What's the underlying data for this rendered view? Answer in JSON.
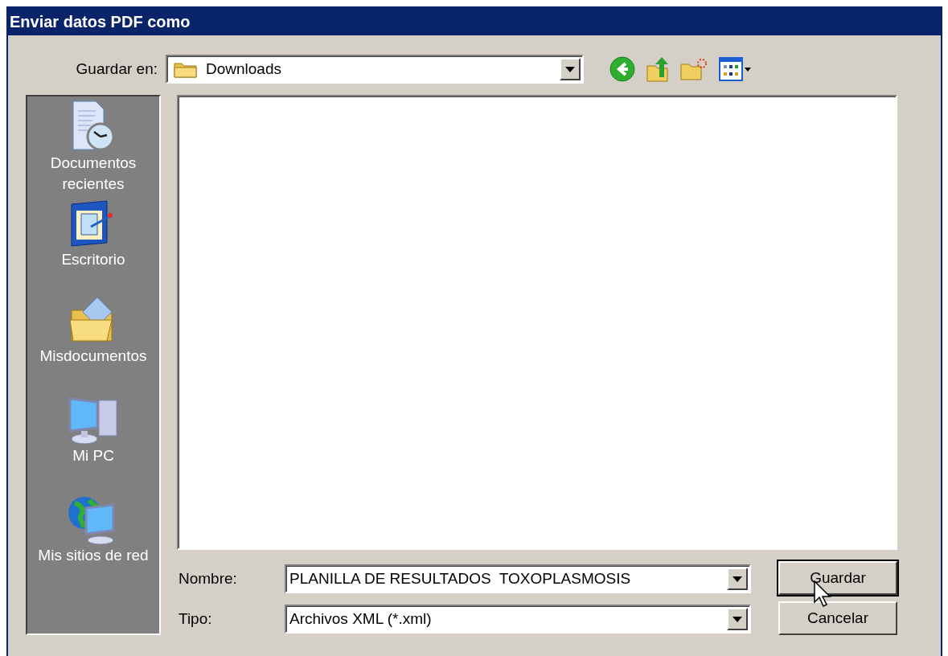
{
  "window": {
    "title": "Enviar datos PDF como"
  },
  "save_in": {
    "label": "Guardar en:",
    "value": "Downloads"
  },
  "places": [
    {
      "kind": "recent",
      "label": "Documentos recientes"
    },
    {
      "kind": "desktop",
      "label": "Escritorio"
    },
    {
      "kind": "documents",
      "label": "Misdocumentos"
    },
    {
      "kind": "computer",
      "label": "Mi PC"
    },
    {
      "kind": "network",
      "label": "Mis sitios de red"
    }
  ],
  "file_name": {
    "label": "Nombre:",
    "value": "PLANILLA DE RESULTADOS  TOXOPLASMOSIS"
  },
  "file_type": {
    "label": "Tipo:",
    "value": "Archivos XML (*.xml)"
  },
  "buttons": [
    {
      "label": "Guardar",
      "default": true
    },
    {
      "label": "Cancelar",
      "default": false
    }
  ]
}
